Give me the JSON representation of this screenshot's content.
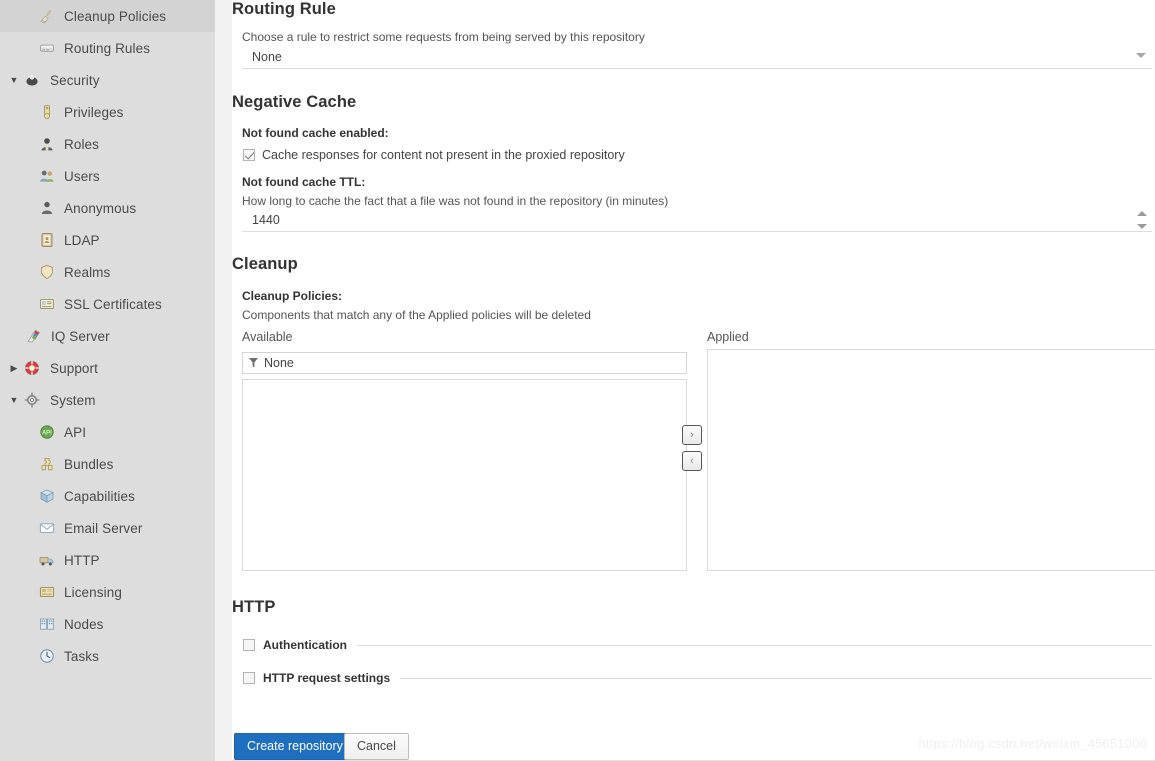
{
  "sidebar": {
    "items": [
      {
        "label": "Cleanup Policies",
        "icon": "broom-icon",
        "level": "child",
        "twisty": ""
      },
      {
        "label": "Routing Rules",
        "icon": "road-icon",
        "level": "child",
        "twisty": ""
      },
      {
        "label": "Security",
        "icon": "security-icon",
        "level": "group",
        "twisty": "expanded"
      },
      {
        "label": "Privileges",
        "icon": "privileges-icon",
        "level": "child",
        "twisty": ""
      },
      {
        "label": "Roles",
        "icon": "roles-icon",
        "level": "child",
        "twisty": ""
      },
      {
        "label": "Users",
        "icon": "users-icon",
        "level": "child",
        "twisty": ""
      },
      {
        "label": "Anonymous",
        "icon": "anonymous-icon",
        "level": "child",
        "twisty": ""
      },
      {
        "label": "LDAP",
        "icon": "ldap-icon",
        "level": "child",
        "twisty": ""
      },
      {
        "label": "Realms",
        "icon": "realms-icon",
        "level": "child",
        "twisty": ""
      },
      {
        "label": "SSL Certificates",
        "icon": "ssl-certificate-icon",
        "level": "child",
        "twisty": ""
      },
      {
        "label": "IQ Server",
        "icon": "iq-server-icon",
        "level": "child2",
        "twisty": ""
      },
      {
        "label": "Support",
        "icon": "support-icon",
        "level": "group",
        "twisty": "collapsed"
      },
      {
        "label": "System",
        "icon": "system-icon",
        "level": "group",
        "twisty": "expanded"
      },
      {
        "label": "API",
        "icon": "api-icon",
        "level": "child",
        "twisty": ""
      },
      {
        "label": "Bundles",
        "icon": "bundles-icon",
        "level": "child",
        "twisty": ""
      },
      {
        "label": "Capabilities",
        "icon": "capabilities-icon",
        "level": "child",
        "twisty": ""
      },
      {
        "label": "Email Server",
        "icon": "email-icon",
        "level": "child",
        "twisty": ""
      },
      {
        "label": "HTTP",
        "icon": "http-icon",
        "level": "child",
        "twisty": ""
      },
      {
        "label": "Licensing",
        "icon": "licensing-icon",
        "level": "child",
        "twisty": ""
      },
      {
        "label": "Nodes",
        "icon": "nodes-icon",
        "level": "child",
        "twisty": ""
      },
      {
        "label": "Tasks",
        "icon": "tasks-icon",
        "level": "child",
        "twisty": ""
      }
    ]
  },
  "routing_rule": {
    "title": "Routing Rule",
    "help": "Choose a rule to restrict some requests from being served by this repository",
    "select_value": "None"
  },
  "negative_cache": {
    "title": "Negative Cache",
    "enabled_label": "Not found cache enabled:",
    "checkbox_label": "Cache responses for content not present in the proxied repository",
    "checkbox_checked": true,
    "ttl_label": "Not found cache TTL:",
    "ttl_help": "How long to cache the fact that a file was not found in the repository (in minutes)",
    "ttl_value": "1440"
  },
  "cleanup": {
    "title": "Cleanup",
    "policies_label": "Cleanup Policies:",
    "policies_help": "Components that match any of the Applied policies will be deleted",
    "available_header": "Available",
    "applied_header": "Applied",
    "available_filter_value": "None",
    "available_items": [],
    "applied_items": [],
    "move_right_label": "›",
    "move_left_label": "‹"
  },
  "http": {
    "title": "HTTP",
    "rules": [
      {
        "label": "Authentication",
        "checked": false
      },
      {
        "label": "HTTP request settings",
        "checked": false
      }
    ]
  },
  "footer": {
    "create_label": "Create repository",
    "cancel_label": "Cancel",
    "watermark": "https://blog.csdn.net/weixin_45651006"
  },
  "colors": {
    "primary": "#1f6fc0",
    "sidebar_bg": "#dddddd",
    "gutter_bg": "#f2f2f2",
    "text": "#444444"
  }
}
